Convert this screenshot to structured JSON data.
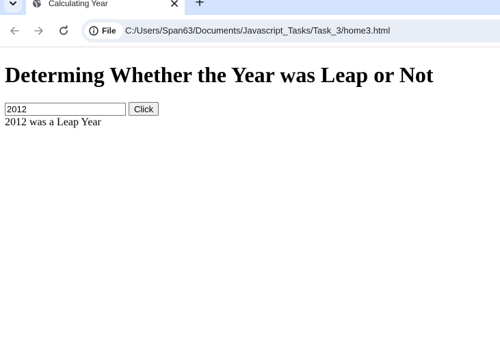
{
  "browser": {
    "tab_title": "Calculating Year",
    "url_chip_label": "File",
    "url": "C:/Users/Span63/Documents/Javascript_Tasks/Task_3/home3.html",
    "icons": {
      "tab_search": "chevron-down-icon",
      "favicon": "globe-icon",
      "tab_close": "close-icon",
      "new_tab": "plus-icon",
      "back": "arrow-left-icon",
      "forward": "arrow-right-icon",
      "reload": "reload-icon",
      "site_info": "info-icon"
    },
    "colors": {
      "tabstrip": "#d3e3fd",
      "omnibox": "#e9eef6"
    }
  },
  "page": {
    "heading": "Determing Whether the Year was Leap or Not",
    "year_input_value": "2012",
    "button_label": "Click",
    "result_text": "2012 was a Leap Year"
  }
}
